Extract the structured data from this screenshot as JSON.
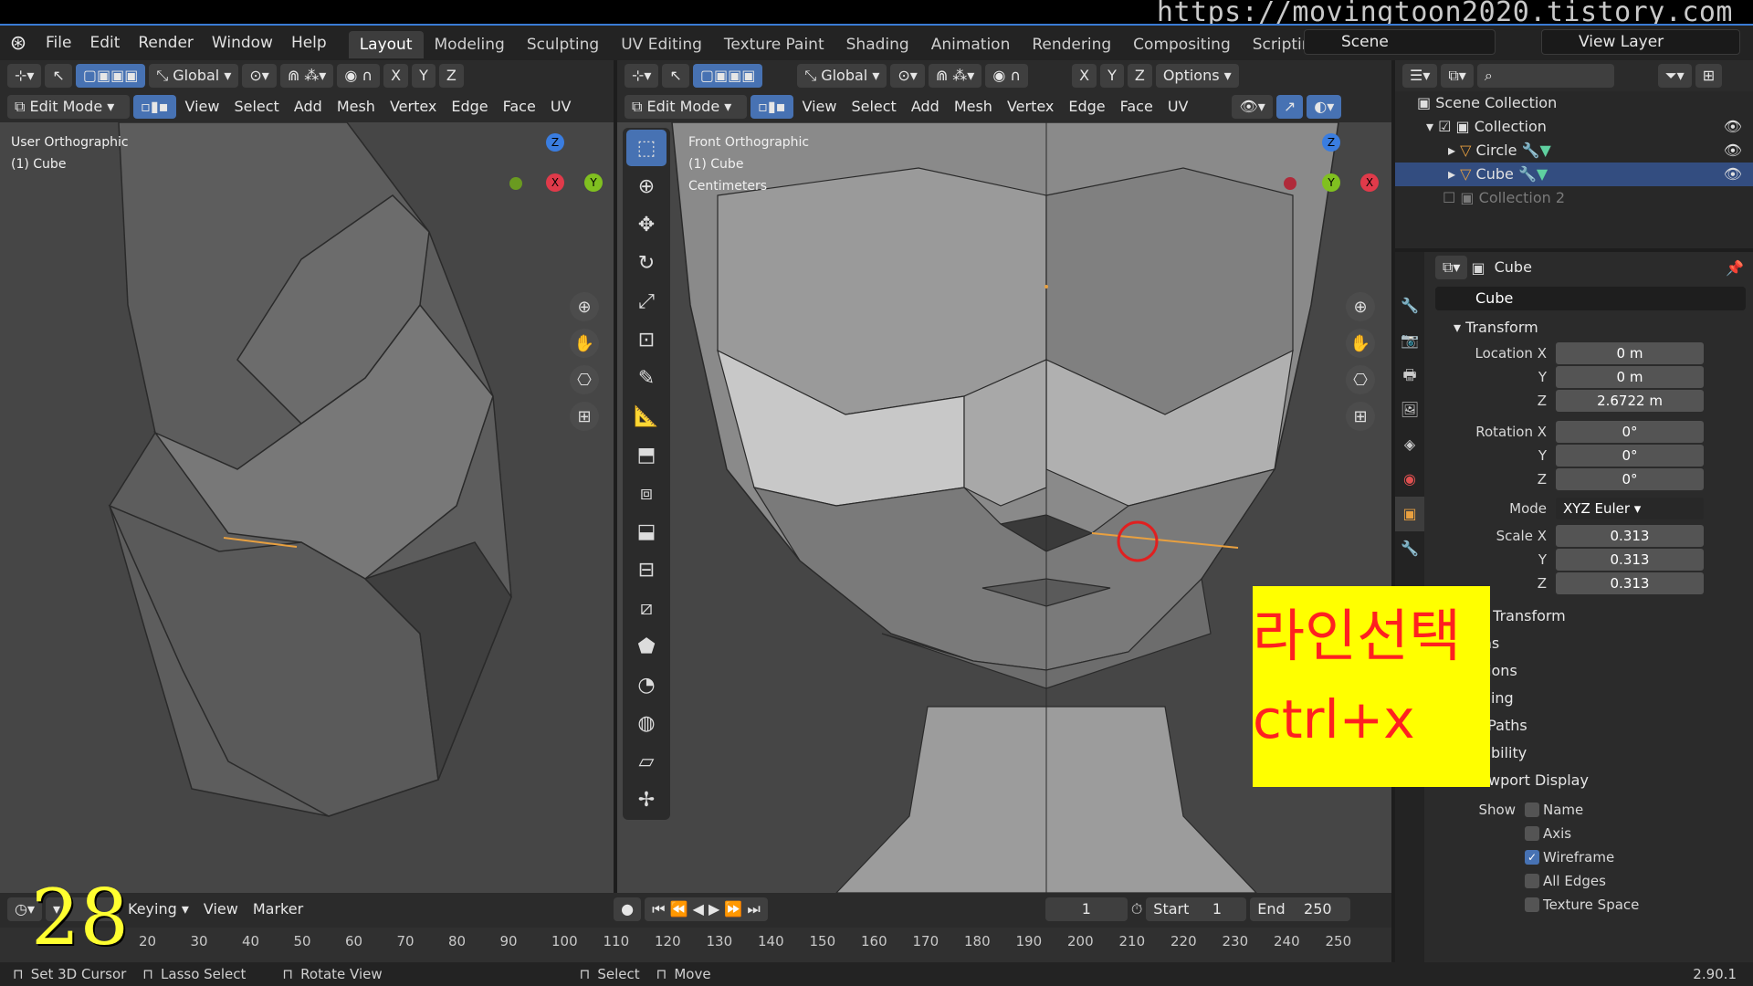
{
  "watermark": "https://movingtoon2020.tistory.com",
  "menu": {
    "items": [
      "File",
      "Edit",
      "Render",
      "Window",
      "Help"
    ]
  },
  "workspaces": [
    "Layout",
    "Modeling",
    "Sculpting",
    "UV Editing",
    "Texture Paint",
    "Shading",
    "Animation",
    "Rendering",
    "Compositing",
    "Scripting"
  ],
  "workspace_add": "+",
  "scene": {
    "name": "Scene",
    "view_layer": "View Layer"
  },
  "left_view": {
    "orientation": "Global",
    "axes": [
      "X",
      "Y",
      "Z"
    ],
    "mode": "Edit Mode",
    "menus": [
      "View",
      "Select",
      "Add",
      "Mesh",
      "Vertex",
      "Edge",
      "Face",
      "UV"
    ],
    "overlay_line1": "User Orthographic",
    "overlay_line2": "(1) Cube"
  },
  "right_view": {
    "orientation": "Global",
    "axes": [
      "X",
      "Y",
      "Z"
    ],
    "options": "Options",
    "mode": "Edit Mode",
    "menus": [
      "View",
      "Select",
      "Add",
      "Mesh",
      "Vertex",
      "Edge",
      "Face",
      "UV"
    ],
    "overlay_line1": "Front Orthographic",
    "overlay_line2": "(1) Cube",
    "overlay_line3": "Centimeters"
  },
  "gizmo_labels": {
    "x": "X",
    "y": "Y",
    "z": "Z"
  },
  "outliner": {
    "root": "Scene Collection",
    "items": [
      {
        "label": "Collection"
      },
      {
        "label": "Circle"
      },
      {
        "label": "Cube"
      },
      {
        "label": "Collection 2"
      }
    ]
  },
  "properties": {
    "object_name": "Cube",
    "object_field": "Cube",
    "transform_title": "Transform",
    "location": {
      "label_x": "Location X",
      "label_y": "Y",
      "label_z": "Z",
      "x": "0 m",
      "y": "0 m",
      "z": "2.6722 m"
    },
    "rotation": {
      "label_x": "Rotation X",
      "label_y": "Y",
      "label_z": "Z",
      "x": "0°",
      "y": "0°",
      "z": "0°"
    },
    "mode_label": "Mode",
    "mode_value": "XYZ Euler",
    "scale": {
      "label_x": "Scale X",
      "label_y": "Y",
      "label_z": "Z",
      "x": "0.313",
      "y": "0.313",
      "z": "0.313"
    },
    "sections": [
      "ta Transform",
      "ons",
      "ctions",
      "ncing",
      "n Paths",
      "Visibility"
    ],
    "viewport_display": "Viewport Display",
    "show_label": "Show",
    "show_items": [
      {
        "label": "Name",
        "checked": false
      },
      {
        "label": "Axis",
        "checked": false
      },
      {
        "label": "Wireframe",
        "checked": true
      },
      {
        "label": "All Edges",
        "checked": false
      },
      {
        "label": "Texture Space",
        "checked": false
      }
    ]
  },
  "annotation": {
    "line1": "라인선택",
    "line2": "ctrl+x",
    "bg": "#ffff00",
    "fg": "#ff2020"
  },
  "step_number": "28",
  "timeline": {
    "keying": "Keying",
    "view": "View",
    "marker": "Marker",
    "current_frame": "1",
    "start_label": "Start",
    "start": "1",
    "end_label": "End",
    "end": "250",
    "ticks": [
      "20",
      "30",
      "40",
      "50",
      "60",
      "70",
      "80",
      "90",
      "100",
      "110",
      "120",
      "130",
      "140",
      "150",
      "160",
      "170",
      "180",
      "190",
      "200",
      "210",
      "220",
      "230",
      "240",
      "250"
    ]
  },
  "status": {
    "items": [
      "Set 3D Cursor",
      "Lasso Select",
      "Rotate View",
      "Select",
      "Move"
    ],
    "version": "2.90.1"
  },
  "colors": {
    "accent": "#4772b3",
    "edge_highlight": "#e8a040",
    "circle": "#e02020"
  }
}
